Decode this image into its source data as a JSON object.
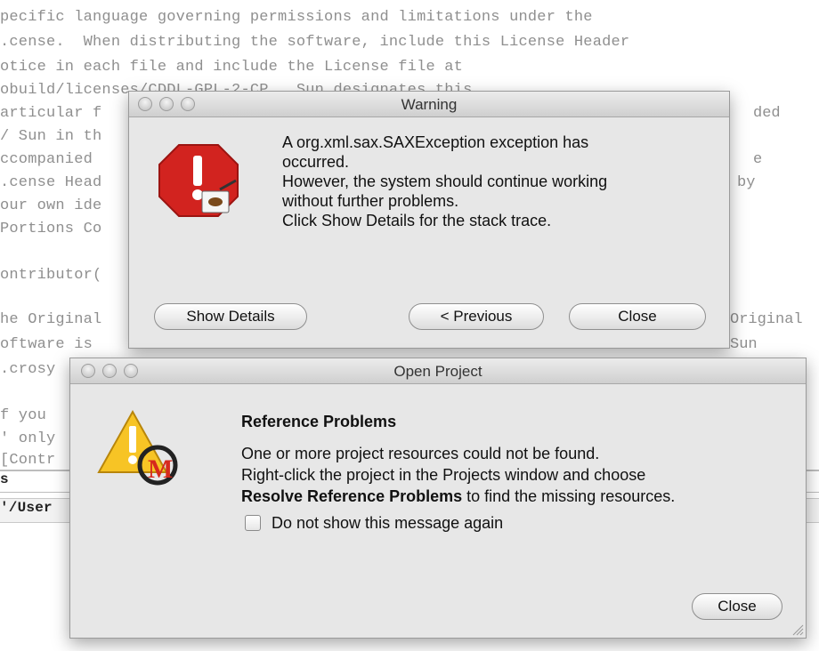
{
  "editor": {
    "lines": [
      "pecific language governing permissions and limitations under the",
      ".cense.  When distributing the software, include this License Header",
      "otice in each file and include the License file at",
      "obuild/licenses/CDDL-GPL-2-CP.  Sun designates this",
      "articular f",
      "/ Sun in th",
      "ccompanied",
      ".cense Head",
      "our own ide",
      "Portions Co",
      "",
      "ontributor(",
      "",
      "he Original",
      "oftware is",
      ".crosy",
      "",
      "f you",
      "' only",
      "[Contr"
    ],
    "right_fragments": [
      "ded",
      "e",
      "by",
      "Original",
      "Sun"
    ],
    "status_line": "s",
    "path_line": "'/User"
  },
  "warning_dialog": {
    "title": "Warning",
    "message_lines": [
      "A org.xml.sax.SAXException exception has",
      "occurred.",
      "However, the system should continue working",
      "without further problems.",
      "Click Show Details for the stack trace."
    ],
    "icon": "stop-sign-icon",
    "buttons": {
      "show_details": "Show Details",
      "previous": "< Previous",
      "close": "Close"
    }
  },
  "open_project_dialog": {
    "title": "Open Project",
    "heading": "Reference Problems",
    "body_line1": "One or more project resources could not be found.",
    "body_line2": "Right-click the project in the Projects window and choose",
    "body_bold": "Resolve Reference Problems",
    "body_tail": " to find the missing resources.",
    "checkbox_label": "Do not show this message again",
    "checkbox_checked": false,
    "icon": "warning-triangle-icon",
    "close_label": "Close"
  }
}
